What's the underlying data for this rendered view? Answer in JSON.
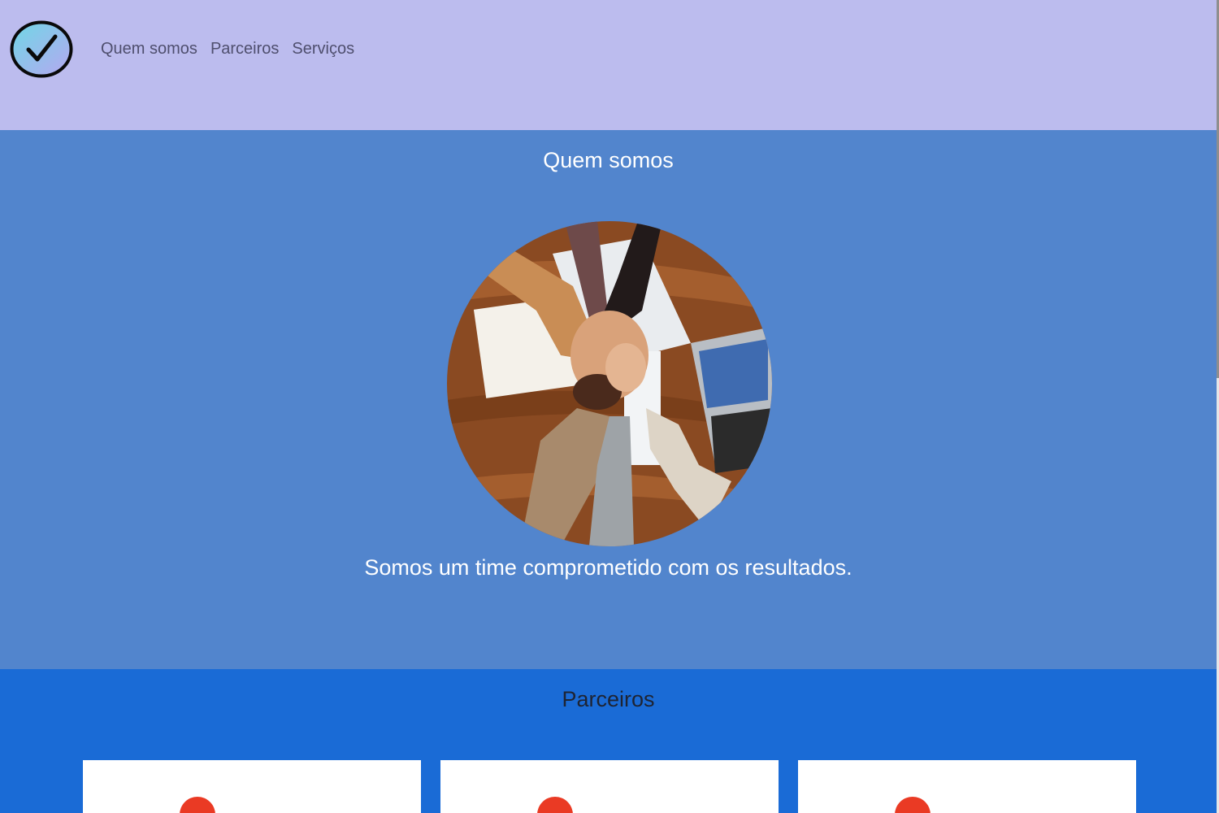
{
  "header": {
    "logo_icon": "check-circle-icon",
    "nav": [
      {
        "label": "Quem somos"
      },
      {
        "label": "Parceiros"
      },
      {
        "label": "Serviços"
      }
    ]
  },
  "about": {
    "title": "Quem somos",
    "image": "team-hands-together-photo",
    "text": "Somos um time comprometido com os resultados."
  },
  "partners": {
    "title": "Parceiros",
    "cards": [
      {
        "icon": "partner-logo-icon"
      },
      {
        "icon": "partner-logo-icon"
      },
      {
        "icon": "partner-logo-icon"
      }
    ]
  },
  "colors": {
    "header_bg": "#bcbcee",
    "about_bg": "#5285cd",
    "partners_bg": "#1a6bd6",
    "accent_red": "#ea3a24"
  }
}
